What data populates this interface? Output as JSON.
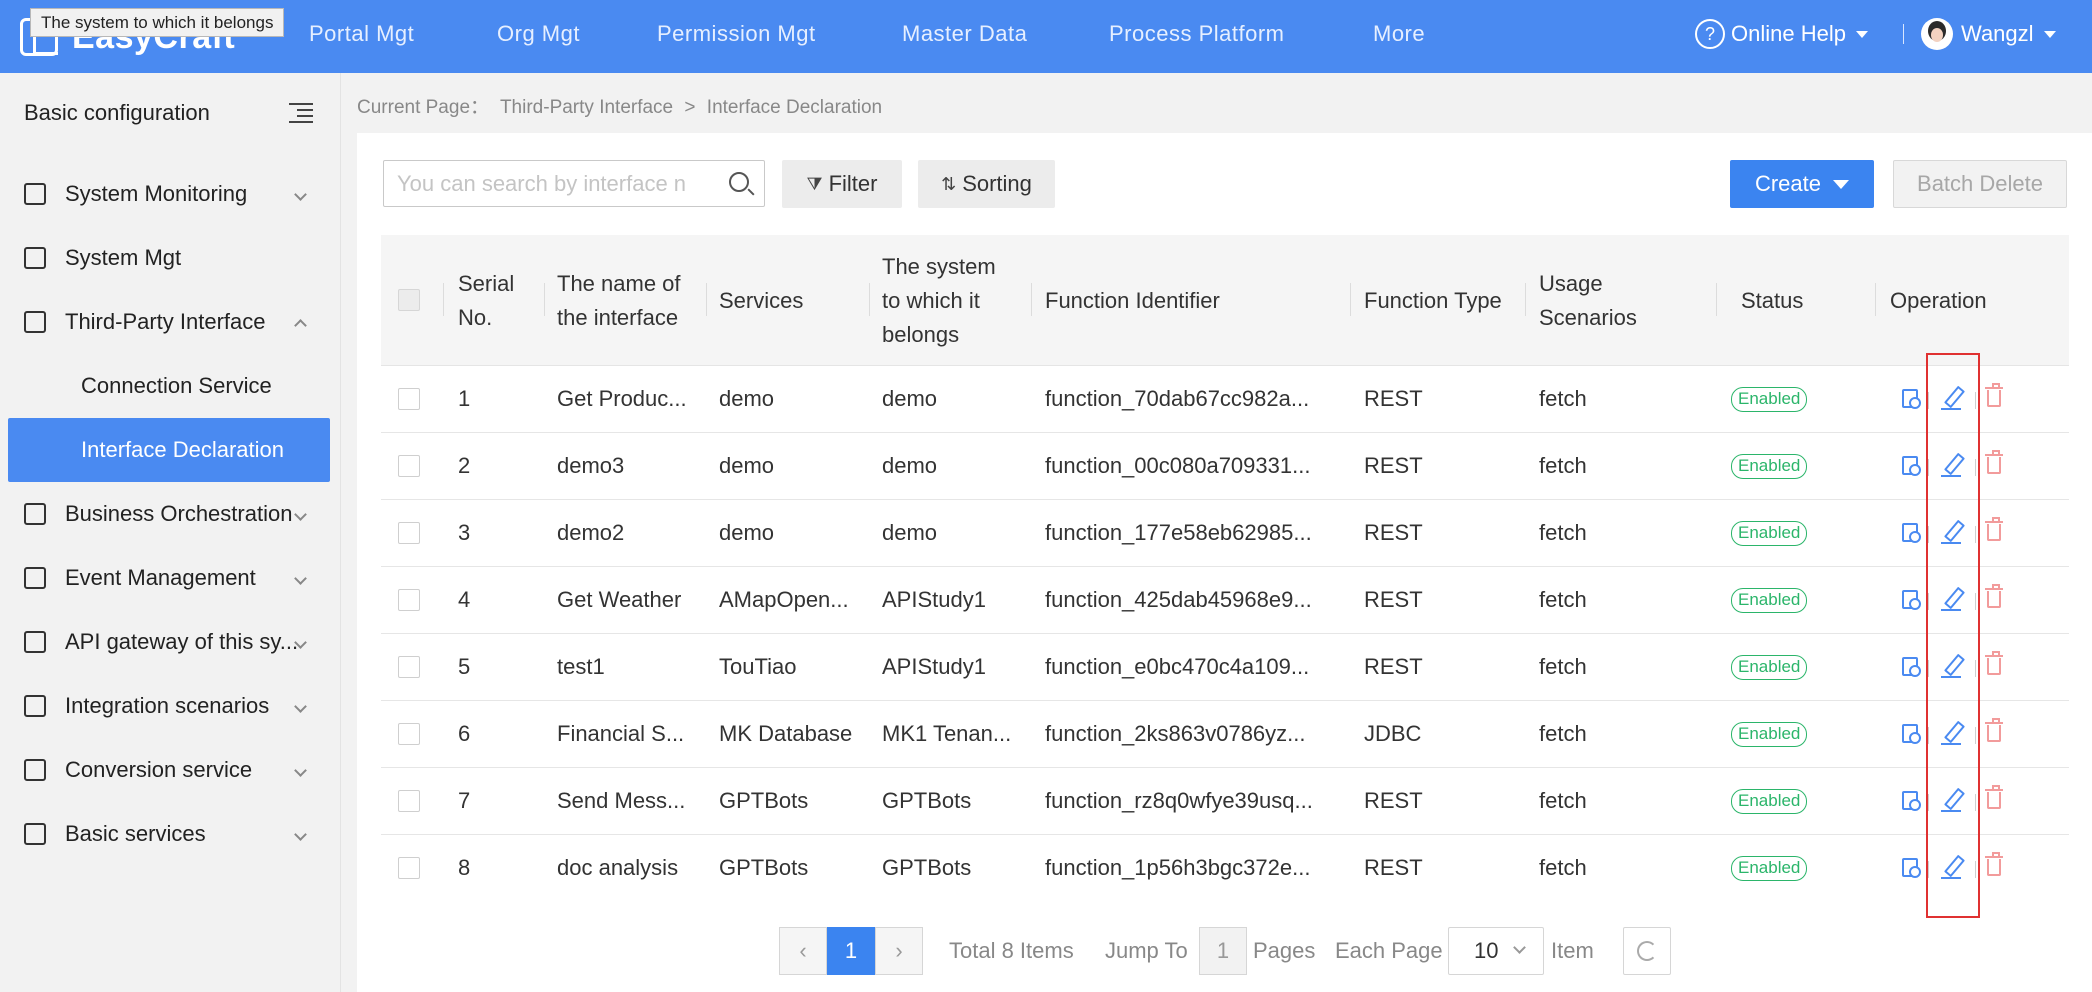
{
  "tooltip": "The system to which it belongs",
  "app": {
    "logo_text": "EasyCraft"
  },
  "nav": [
    "Portal Mgt",
    "Org Mgt",
    "Permission Mgt",
    "Master Data",
    "Process Platform",
    "More"
  ],
  "header": {
    "help": "Online Help",
    "help_icon": "?",
    "user": "Wangzl"
  },
  "sidebar": {
    "title": "Basic configuration",
    "items": [
      {
        "label": "System Monitoring",
        "icon": "monitor-icon"
      },
      {
        "label": "System Mgt",
        "icon": "window-icon"
      },
      {
        "label": "Third-Party Interface",
        "icon": "document-icon"
      },
      {
        "label": "Business Orchestration",
        "icon": "orchestration-icon"
      },
      {
        "label": "Event Management",
        "icon": "event-icon"
      },
      {
        "label": "API gateway of this sy...",
        "icon": "link-icon"
      },
      {
        "label": "Integration scenarios",
        "icon": "layout-icon"
      },
      {
        "label": "Conversion service",
        "icon": "convert-icon"
      },
      {
        "label": "Basic services",
        "icon": "layers-icon"
      }
    ],
    "sub_items": [
      {
        "label": "Connection Service"
      },
      {
        "label": "Interface Declaration"
      }
    ]
  },
  "breadcrumb": {
    "prefix": "Current Page：",
    "parent": "Third-Party Interface",
    "separator": ">",
    "current": "Interface Declaration"
  },
  "toolbar": {
    "search_placeholder": "You can search by interface n",
    "filter": "Filter",
    "filter_icon": "⧩",
    "sorting": "Sorting",
    "sorting_icon": "⇅",
    "create": "Create",
    "batch_delete": "Batch Delete"
  },
  "table": {
    "headers": {
      "serial_l1": "Serial",
      "serial_l2": "No.",
      "name_l1": "The name of",
      "name_l2": "the interface",
      "services": "Services",
      "system_l1": "The system",
      "system_l2": "to which it",
      "system_l3": "belongs",
      "function_identifier": "Function Identifier",
      "function_type": "Function Type",
      "usage_l1": "Usage",
      "usage_l2": "Scenarios",
      "status": "Status",
      "operation": "Operation"
    },
    "rows": [
      {
        "no": "1",
        "name": "Get Produc...",
        "services": "demo",
        "system": "demo",
        "function_id": "function_70dab67cc982a...",
        "type": "REST",
        "usage": "fetch",
        "status": "Enabled"
      },
      {
        "no": "2",
        "name": "demo3",
        "services": "demo",
        "system": "demo",
        "function_id": "function_00c080a709331...",
        "type": "REST",
        "usage": "fetch",
        "status": "Enabled"
      },
      {
        "no": "3",
        "name": "demo2",
        "services": "demo",
        "system": "demo",
        "function_id": "function_177e58eb62985...",
        "type": "REST",
        "usage": "fetch",
        "status": "Enabled"
      },
      {
        "no": "4",
        "name": "Get Weather",
        "services": "AMapOpen...",
        "system": "APIStudy1",
        "function_id": "function_425dab45968e9...",
        "type": "REST",
        "usage": "fetch",
        "status": "Enabled"
      },
      {
        "no": "5",
        "name": "test1",
        "services": "TouTiao",
        "system": "APIStudy1",
        "function_id": "function_e0bc470c4a109...",
        "type": "REST",
        "usage": "fetch",
        "status": "Enabled"
      },
      {
        "no": "6",
        "name": "Financial S...",
        "services": "MK Database",
        "system": "MK1 Tenan...",
        "function_id": "function_2ks863v0786yz...",
        "type": "JDBC",
        "usage": "fetch",
        "status": "Enabled"
      },
      {
        "no": "7",
        "name": "Send Mess...",
        "services": "GPTBots",
        "system": "GPTBots",
        "function_id": "function_rz8q0wfye39usq...",
        "type": "REST",
        "usage": "fetch",
        "status": "Enabled"
      },
      {
        "no": "8",
        "name": "doc analysis",
        "services": "GPTBots",
        "system": "GPTBots",
        "function_id": "function_1p56h3bgc372e...",
        "type": "REST",
        "usage": "fetch",
        "status": "Enabled"
      }
    ]
  },
  "pagination": {
    "prev": "‹",
    "current_page": "1",
    "next": "›",
    "total": "Total 8 Items",
    "jump_to": "Jump To",
    "jump_value": "1",
    "pages": "Pages",
    "each_page": "Each Page",
    "page_size": "10",
    "item": "Item"
  },
  "colors": {
    "primary": "#4a8af1",
    "enabled": "#2bb56a",
    "delete": "#f29b9b",
    "highlight": "#e03131"
  }
}
